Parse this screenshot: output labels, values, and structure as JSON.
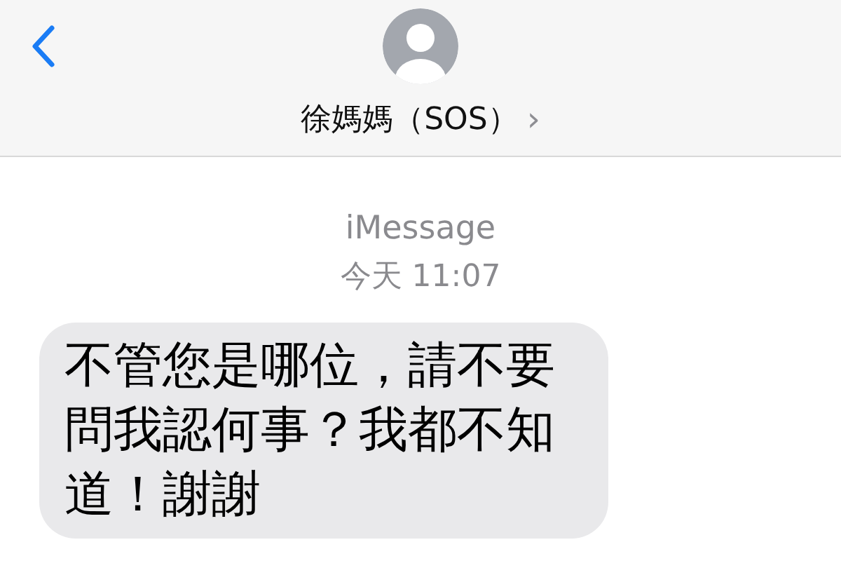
{
  "header": {
    "contact_name": "徐媽媽（SOS）",
    "chevron": "›"
  },
  "thread": {
    "service": "iMessage",
    "timestamp": "今天 11:07"
  },
  "messages": [
    {
      "text": "不管您是哪位，請不要問我認何事？我都不知道！謝謝",
      "kind": "incoming"
    }
  ]
}
